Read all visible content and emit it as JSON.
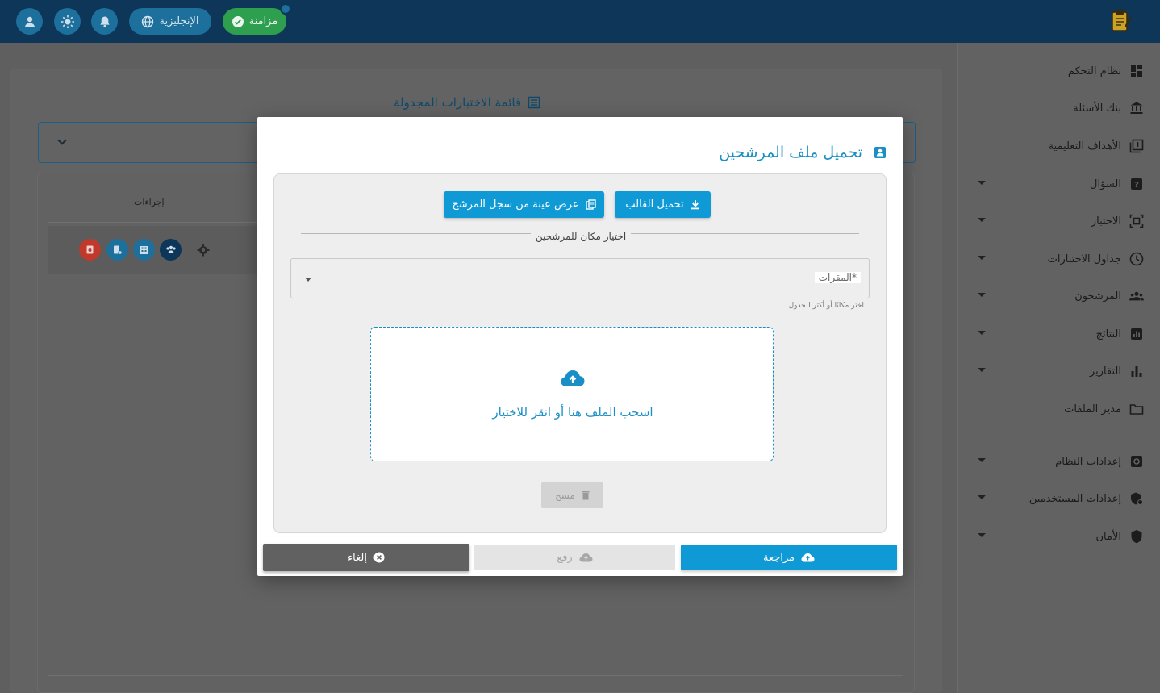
{
  "topbar": {
    "sync_label": "مزامنة",
    "language_label": "الإنجليزية"
  },
  "sidebar": {
    "items": [
      {
        "label": "نظام التحكم",
        "icon": "dashboard-icon",
        "expandable": false
      },
      {
        "label": "بنك الأسئلة",
        "icon": "bank-icon",
        "expandable": false
      },
      {
        "label": "الأهداف التعليمية",
        "icon": "objectives-icon",
        "expandable": false
      },
      {
        "label": "السؤال",
        "icon": "question-icon",
        "expandable": true
      },
      {
        "label": "الاختبار",
        "icon": "exam-icon",
        "expandable": true
      },
      {
        "label": "جداول الاختبارات",
        "icon": "clock-icon",
        "expandable": true
      },
      {
        "label": "المرشحون",
        "icon": "people-icon",
        "expandable": true
      },
      {
        "label": "النتائج",
        "icon": "results-icon",
        "expandable": true
      },
      {
        "label": "التقارير",
        "icon": "bar-chart-icon",
        "expandable": true
      },
      {
        "label": "مدير الملفات",
        "icon": "folder-icon",
        "expandable": false
      },
      {
        "label": "إعدادات النظام",
        "icon": "settings-icon",
        "expandable": true
      },
      {
        "label": "إعدادات المستخدمين",
        "icon": "user-shield-icon",
        "expandable": true
      },
      {
        "label": "الأمان",
        "icon": "shield-icon",
        "expandable": true
      }
    ]
  },
  "background_page": {
    "title": "قائمة الاختبارات المجدولة",
    "actions_header": "إجراءات"
  },
  "modal": {
    "title": "تحميل ملف المرشحين",
    "download_template_label": "تحميل القالب",
    "view_sample_label": "عرض عينة من سجل المرشح",
    "location_section_label": "اختيار مكان للمرشحين",
    "courses_field_label": "المقرات*",
    "courses_field_hint": "اختر مكانًا أو أكثر للجدول",
    "dropzone_text": "اسحب الملف هنا أو انقر للاختيار",
    "clear_label": "مسح",
    "review_label": "مراجعة",
    "upload_label": "رفع",
    "cancel_label": "إلغاء"
  },
  "colors": {
    "topbar": "#0d3658",
    "accent": "#0f9ad6",
    "sync_green": "#2e9e4f",
    "danger": "#d9463a"
  }
}
